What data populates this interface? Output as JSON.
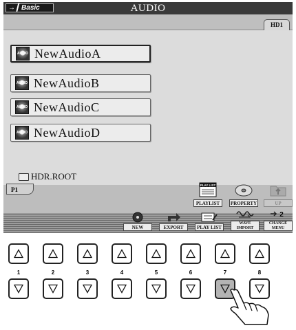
{
  "header": {
    "mode_label": "Basic",
    "title": "AUDIO"
  },
  "drive_tab": "HD1",
  "files": [
    {
      "name": "NewAudioA",
      "icon": "audio-file-icon",
      "icon_text": "AUDIO",
      "selected": true
    },
    {
      "name": "NewAudioB",
      "icon": "audio-file-icon",
      "icon_text": "AUDIO"
    },
    {
      "name": "NewAudioC",
      "icon": "audio-file-icon",
      "icon_text": "AUDIO"
    },
    {
      "name": "NewAudioD",
      "icon": "audio-file-icon",
      "icon_text": "AUDIO"
    }
  ],
  "current_folder": "HDR.ROOT",
  "page_tab": "P1",
  "top_buttons": {
    "playlist": {
      "label": "PLAYLIST",
      "icon_text": "PLAY LIST"
    },
    "property": {
      "label": "PROPERTY"
    },
    "up": {
      "label": "UP"
    }
  },
  "bottom_buttons": {
    "new": {
      "label": "NEW"
    },
    "export": {
      "label": "EXPORT"
    },
    "play_list": {
      "label": "PLAY LIST"
    },
    "wave_import": {
      "label": "WAVE IMPORT"
    },
    "change_menu": {
      "label": "CHANGE MENU",
      "icon_text": "2"
    }
  },
  "panel_keys": {
    "numbers": [
      "1",
      "2",
      "3",
      "4",
      "5",
      "6",
      "7",
      "8"
    ],
    "pressed": {
      "row": "lower",
      "number": "7"
    }
  }
}
